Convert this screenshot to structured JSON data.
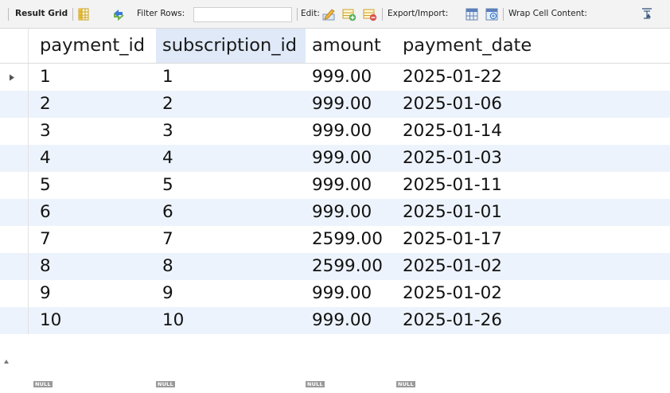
{
  "toolbar": {
    "result_grid": "Result Grid",
    "filter_rows": "Filter Rows:",
    "filter_value": "",
    "edit": "Edit:",
    "export_import": "Export/Import:",
    "wrap_cell_content": "Wrap Cell Content:",
    "icons": [
      "grid-layout-icon",
      "refresh-arrows-icon",
      "edit-row-icon",
      "add-row-icon",
      "delete-row-icon",
      "export-icon",
      "import-icon",
      "wrap-text-icon"
    ]
  },
  "grid": {
    "columns": [
      "payment_id",
      "subscription_id",
      "amount",
      "payment_date"
    ],
    "selected_column": "subscription_id",
    "rows": [
      [
        "1",
        "1",
        "999.00",
        "2025-01-22"
      ],
      [
        "2",
        "2",
        "999.00",
        "2025-01-06"
      ],
      [
        "3",
        "3",
        "999.00",
        "2025-01-14"
      ],
      [
        "4",
        "4",
        "999.00",
        "2025-01-03"
      ],
      [
        "5",
        "5",
        "999.00",
        "2025-01-11"
      ],
      [
        "6",
        "6",
        "999.00",
        "2025-01-01"
      ],
      [
        "7",
        "7",
        "2599.00",
        "2025-01-17"
      ],
      [
        "8",
        "8",
        "2599.00",
        "2025-01-02"
      ],
      [
        "9",
        "9",
        "999.00",
        "2025-01-02"
      ],
      [
        "10",
        "10",
        "999.00",
        "2025-01-26"
      ]
    ],
    "null_label": "NULL",
    "current_row": 0,
    "colors": {
      "alt_row": "#edf3fc",
      "selected_header": "#dfe9f7",
      "null_badge": "#9a9a9a"
    }
  }
}
